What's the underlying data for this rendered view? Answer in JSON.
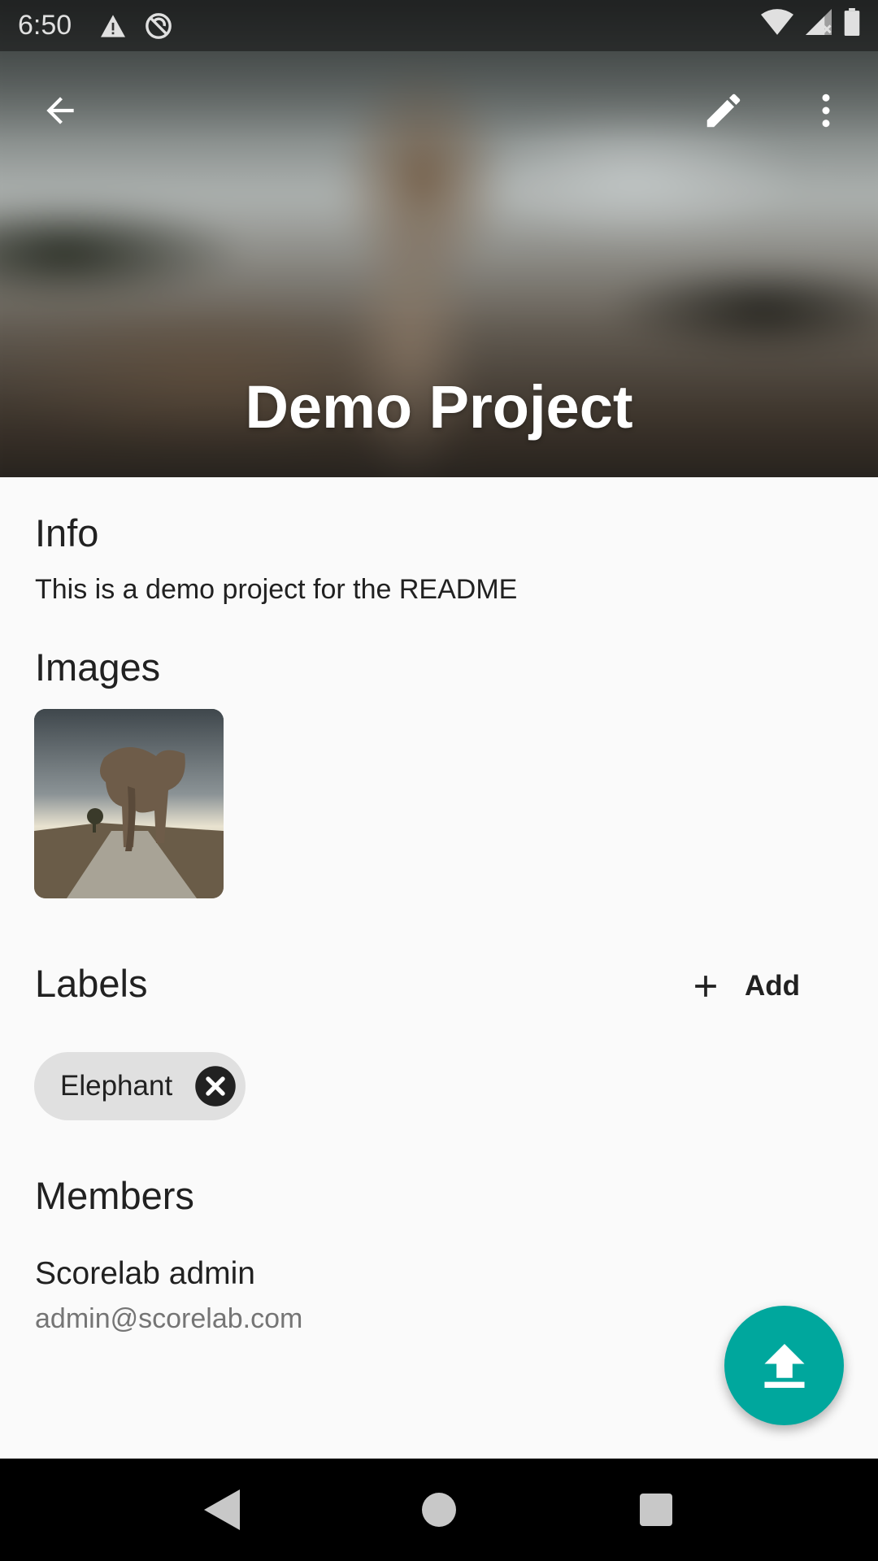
{
  "status_bar": {
    "time": "6:50"
  },
  "header": {
    "title": "Demo Project",
    "back_icon": "arrow-back-icon",
    "edit_icon": "pencil-icon",
    "more_icon": "more-vert-icon"
  },
  "info": {
    "title": "Info",
    "description": "This is a demo project for the README"
  },
  "images": {
    "title": "Images"
  },
  "labels": {
    "title": "Labels",
    "add_label": "Add",
    "chips": [
      {
        "label": "Elephant"
      }
    ]
  },
  "members": {
    "title": "Members",
    "items": [
      {
        "name": "Scorelab admin",
        "email": "admin@scorelab.com"
      }
    ]
  },
  "fab": {
    "icon": "upload-icon",
    "color": "#00a79d"
  }
}
